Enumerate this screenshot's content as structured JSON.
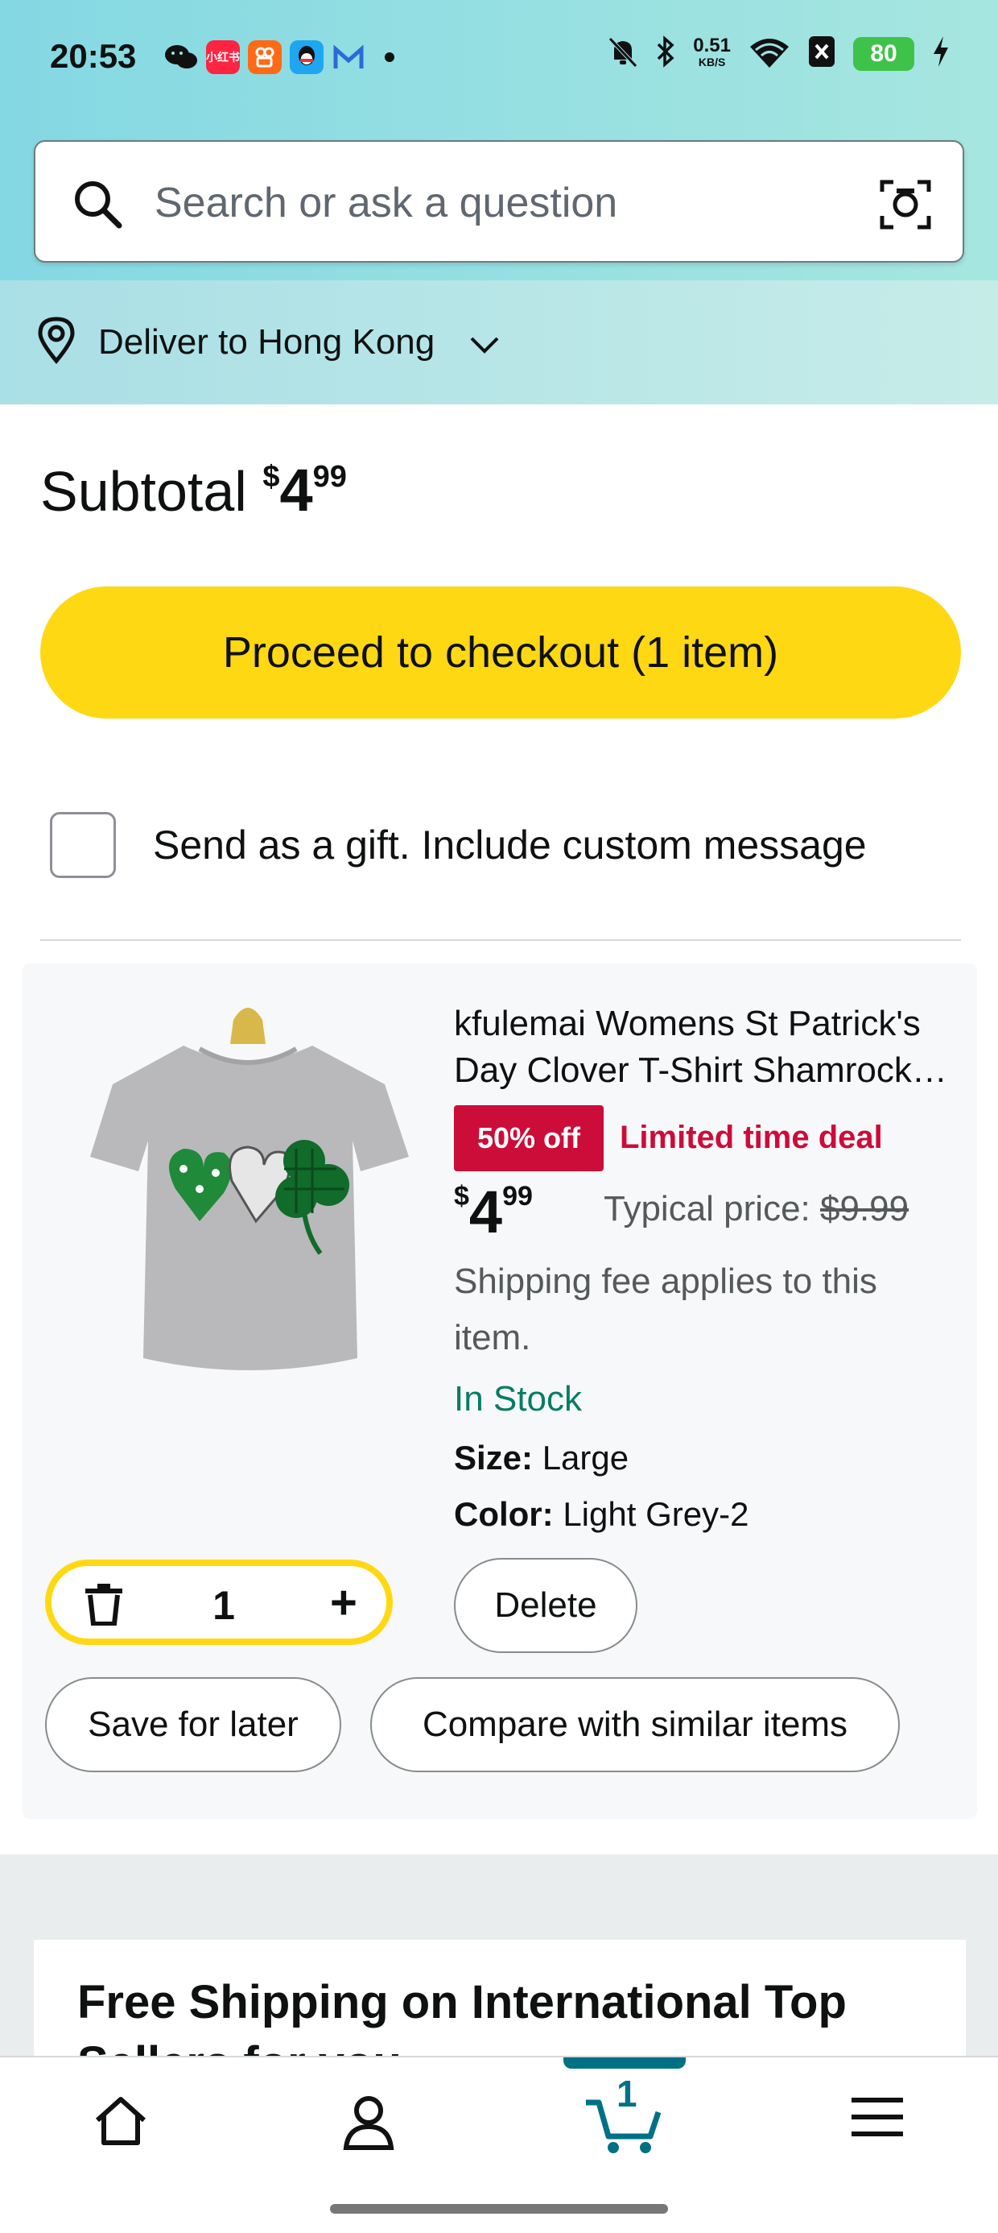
{
  "status_bar": {
    "time": "20:53",
    "net_speed_value": "0.51",
    "net_speed_unit": "KB/S",
    "battery": "80",
    "app_icons": [
      "wechat-icon",
      "xiaohongshu-icon",
      "kuaishou-icon",
      "qq-icon",
      "mail-icon"
    ],
    "system_icons": [
      "mute-bell-icon",
      "bluetooth-icon",
      "wifi-icon",
      "sim-icon",
      "battery-icon",
      "charging-icon"
    ]
  },
  "search": {
    "placeholder": "Search or ask a question",
    "value": "",
    "icon_left": "search-icon",
    "icon_right": "camera-lens-icon"
  },
  "delivery": {
    "label": "Deliver to Hong Kong",
    "icon": "location-pin-icon"
  },
  "cart": {
    "subtotal_label": "Subtotal",
    "subtotal_currency": "$",
    "subtotal_whole": "4",
    "subtotal_cents": "99",
    "checkout_label": "Proceed to checkout (1 item)",
    "gift_label": "Send as a gift. Include custom message",
    "gift_checked": false
  },
  "item": {
    "title": "kfulemai Womens St Patrick's Day Clover T-Shirt Shamrock Graphic Tee",
    "discount_badge": "50% off",
    "deal_label": "Limited time deal",
    "price_currency": "$",
    "price_whole": "4",
    "price_cents": "99",
    "typical_label": "Typical price:",
    "typical_price": "$9.99",
    "shipping_note": "Shipping fee applies to this item.",
    "stock": "In Stock",
    "size_label": "Size:",
    "size_value": "Large",
    "color_label": "Color:",
    "color_value": "Light Grey-2",
    "quantity": "1",
    "delete_label": "Delete",
    "save_label": "Save for later",
    "compare_label": "Compare with similar items"
  },
  "promo": {
    "title": "Free Shipping on International Top Sellers for you"
  },
  "nav": {
    "items": [
      "home-icon",
      "account-icon",
      "cart-icon",
      "menu-icon"
    ],
    "cart_count": "1",
    "active": "cart"
  },
  "colors": {
    "checkout_yellow": "#ffd814",
    "deal_red": "#cc0c39",
    "stock_green": "#067d62",
    "teal_active": "#007185"
  }
}
